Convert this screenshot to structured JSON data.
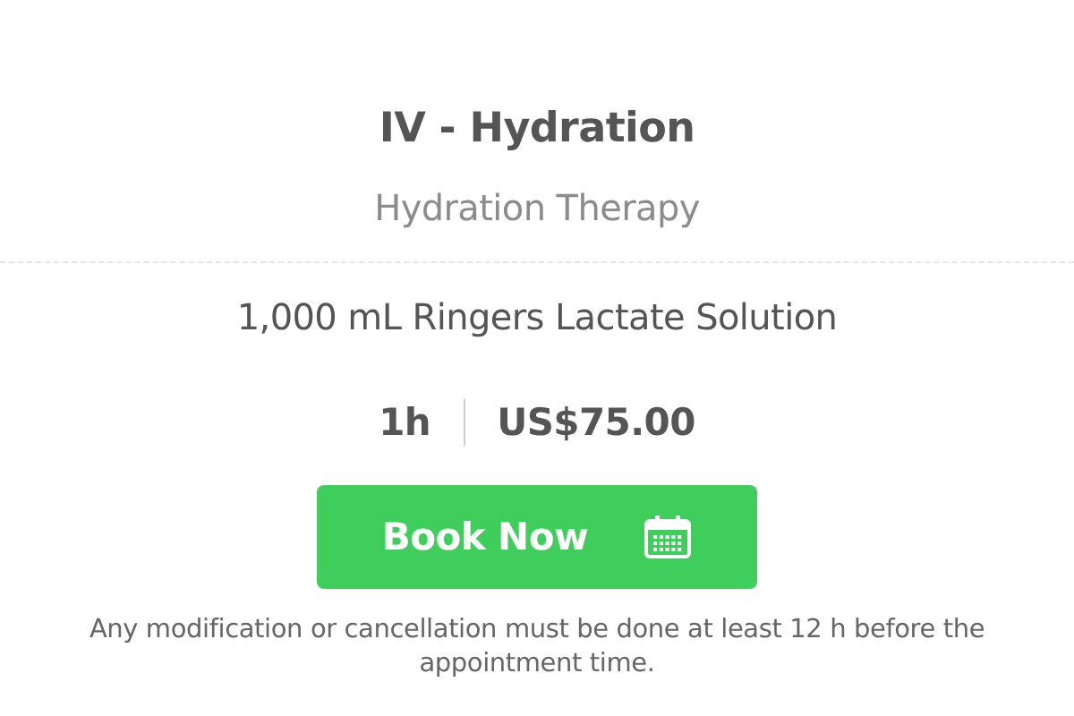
{
  "service": {
    "title": "IV - Hydration",
    "category": "Hydration Therapy",
    "description": "1,000 mL Ringers Lactate Solution",
    "duration": "1h",
    "price": "US$75.00"
  },
  "book_button": {
    "label": "Book Now"
  },
  "note": "Any modification or cancellation must be done at least 12 h before the appointment time."
}
